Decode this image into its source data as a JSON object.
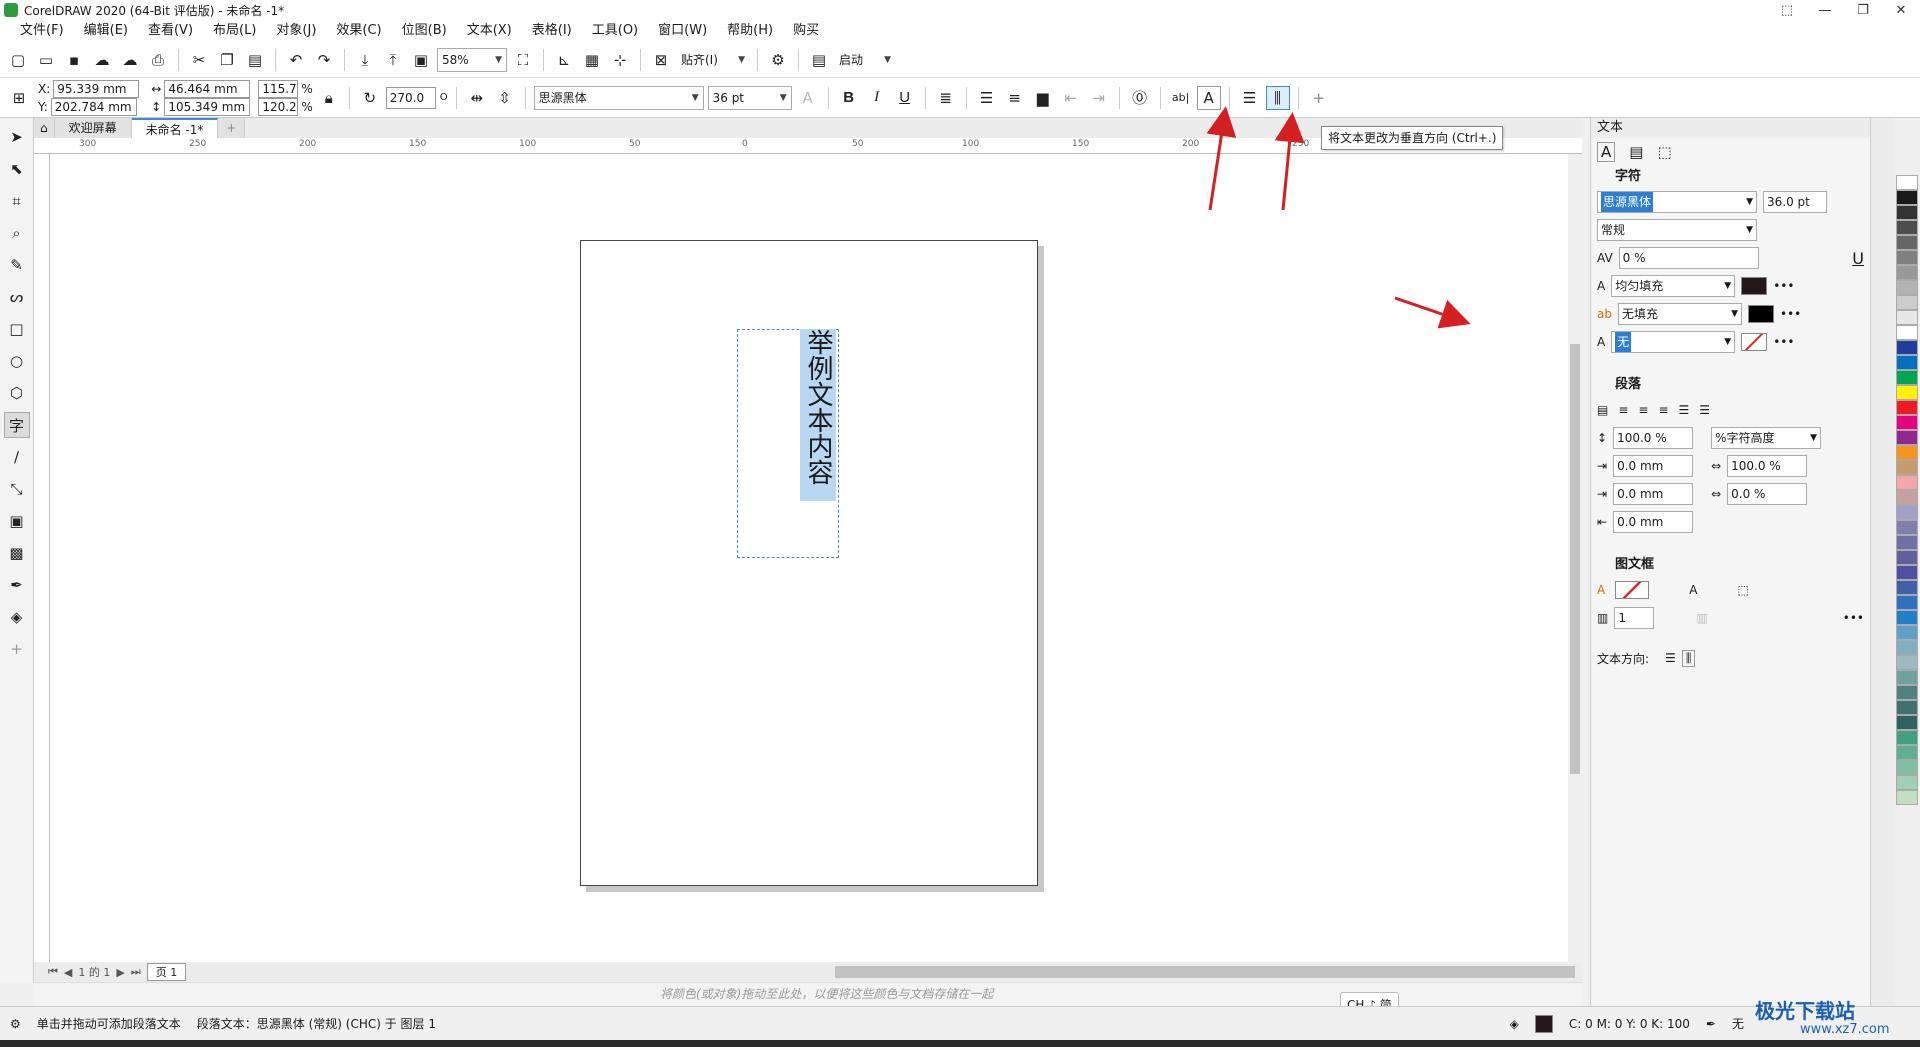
{
  "window": {
    "title": "CorelDRAW 2020 (64-Bit 评估版) - 未命名 -1*",
    "controls": [
      "⬚",
      "—",
      "❐",
      "✕"
    ]
  },
  "menu": [
    "文件(F)",
    "编辑(E)",
    "查看(V)",
    "布局(L)",
    "对象(J)",
    "效果(C)",
    "位图(B)",
    "文本(X)",
    "表格(I)",
    "工具(O)",
    "窗口(W)",
    "帮助(H)",
    "购买"
  ],
  "toolbar1": {
    "zoom": "58%",
    "snap_label": "贴齐(I)",
    "launch_label": "启动"
  },
  "toolbar2": {
    "x_label": "X:",
    "x_value": "95.339 mm",
    "y_label": "Y:",
    "y_value": "202.784 mm",
    "width_value": "46.464 mm",
    "height_value": "105.349 mm",
    "scale_x": "115.7",
    "scale_y": "120.2",
    "percent": "%",
    "rotation": "270.0",
    "degree": "O",
    "font": "思源黑体",
    "size": "36 pt",
    "bold": "B",
    "italic": "I",
    "underline": "U",
    "ab_label": "ab|",
    "plus": "+"
  },
  "tooltip": "将文本更改为垂直方向 (Ctrl+.)",
  "tabs": [
    "欢迎屏幕",
    "未命名 -1*"
  ],
  "ruler_labels": [
    "300",
    "250",
    "200",
    "150",
    "100",
    "50",
    "0",
    "50",
    "100",
    "150",
    "200",
    "250"
  ],
  "canvas": {
    "vertical_text": "举例文本内容"
  },
  "pager": {
    "page_info": "1 的 1",
    "page_tab": "页 1"
  },
  "palette_hint": "将颜色(或对象)拖动至此处，以便将这些颜色与文档存储在一起",
  "status": {
    "hint": "单击并拖动可添加段落文本",
    "info": "段落文本：思源黑体 (常规) (CHC) 于 图层 1",
    "color_readout": "C: 0 M: 0 Y: 0 K: 100",
    "outline": "无",
    "ime": "CH ♪ 简"
  },
  "panel": {
    "title": "文本",
    "char_section": "字符",
    "font": "思源黑体",
    "size": "36.0 pt",
    "style": "常规",
    "kerning": "0 %",
    "fill1": "均匀填充",
    "fill2": "无填充",
    "outline": "无",
    "para_section": "段落",
    "line_spacing": "100.0 %",
    "spacing_unit": "%字符高度",
    "indent1": "0.0 mm",
    "indent2": "0.0 mm",
    "indent3": "0.0 mm",
    "char_spacing": "100.0 %",
    "word_spacing": "0.0 %",
    "frame_section": "图文框",
    "columns": "1",
    "text_direction": "文本方向:"
  },
  "colors": {
    "accent": "#3c8bd9",
    "arrow": "#d42020",
    "highlight": "#b9d7f2",
    "palette": [
      "#ffffff",
      "#1a1a1a",
      "#333333",
      "#4d4d4d",
      "#666666",
      "#808080",
      "#999999",
      "#b3b3b3",
      "#cccccc",
      "#e6e6e6",
      "#ffffff",
      "#1f3f9f",
      "#0070c0",
      "#00a651",
      "#fff200",
      "#ed1c24",
      "#e4007f",
      "#92278f",
      "#f7941d",
      "#c69c6d",
      "#f4a7a7",
      "#c8a0a0",
      "#a0a0c8",
      "#8080b0",
      "#7070a8",
      "#6060a0",
      "#5050a0",
      "#4060a8",
      "#3070c0",
      "#2080c8",
      "#60a0c8",
      "#80b0c0",
      "#a0b8c0",
      "#70a0a0",
      "#508080",
      "#407070",
      "#306060",
      "#40a080",
      "#60b090",
      "#80c0a0",
      "#a0d0b0",
      "#c0e0c0"
    ]
  },
  "watermark": {
    "main": "极光下载站",
    "sub": "www.xz7.com"
  }
}
